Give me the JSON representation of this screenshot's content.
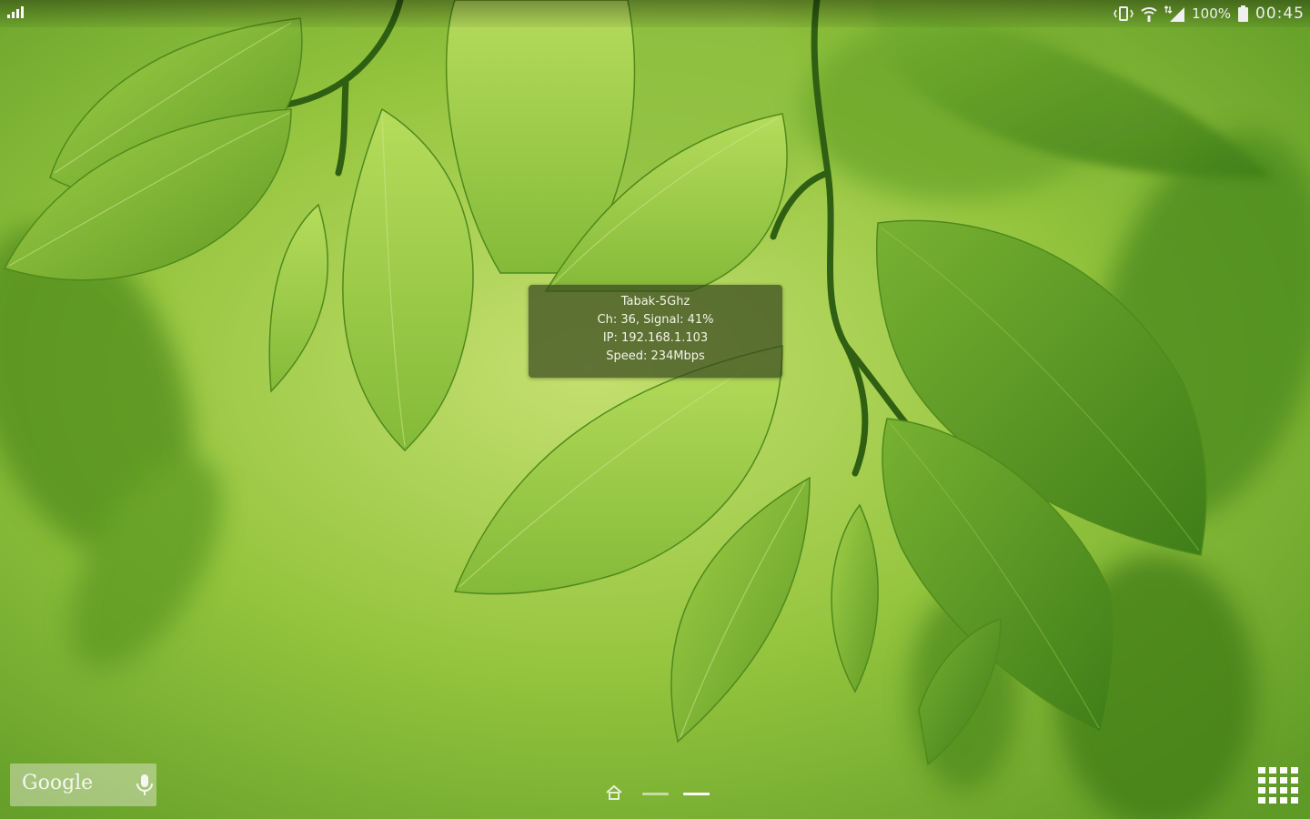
{
  "status_bar": {
    "battery_text": "100%",
    "clock": "00:45",
    "icons": [
      "signal-icon",
      "vibrate-icon",
      "wifi-icon",
      "mobile-data-icon",
      "battery-icon"
    ]
  },
  "wifi_widget": {
    "ssid": "Tabak-5Ghz",
    "channel_signal": "Ch: 36, Signal: 41%",
    "ip": "IP: 192.168.1.103",
    "speed": "Speed: 234Mbps"
  },
  "google_bar": {
    "logo_text": "Google",
    "mic_icon": "mic-icon"
  },
  "home_screen": {
    "pages": 2,
    "current_page": 2,
    "apps_icon": "apps-grid-icon"
  },
  "colors": {
    "wallpaper_base": "#8fc23f",
    "leaf": "#6fa42a",
    "widget_bg": "#37481e"
  }
}
